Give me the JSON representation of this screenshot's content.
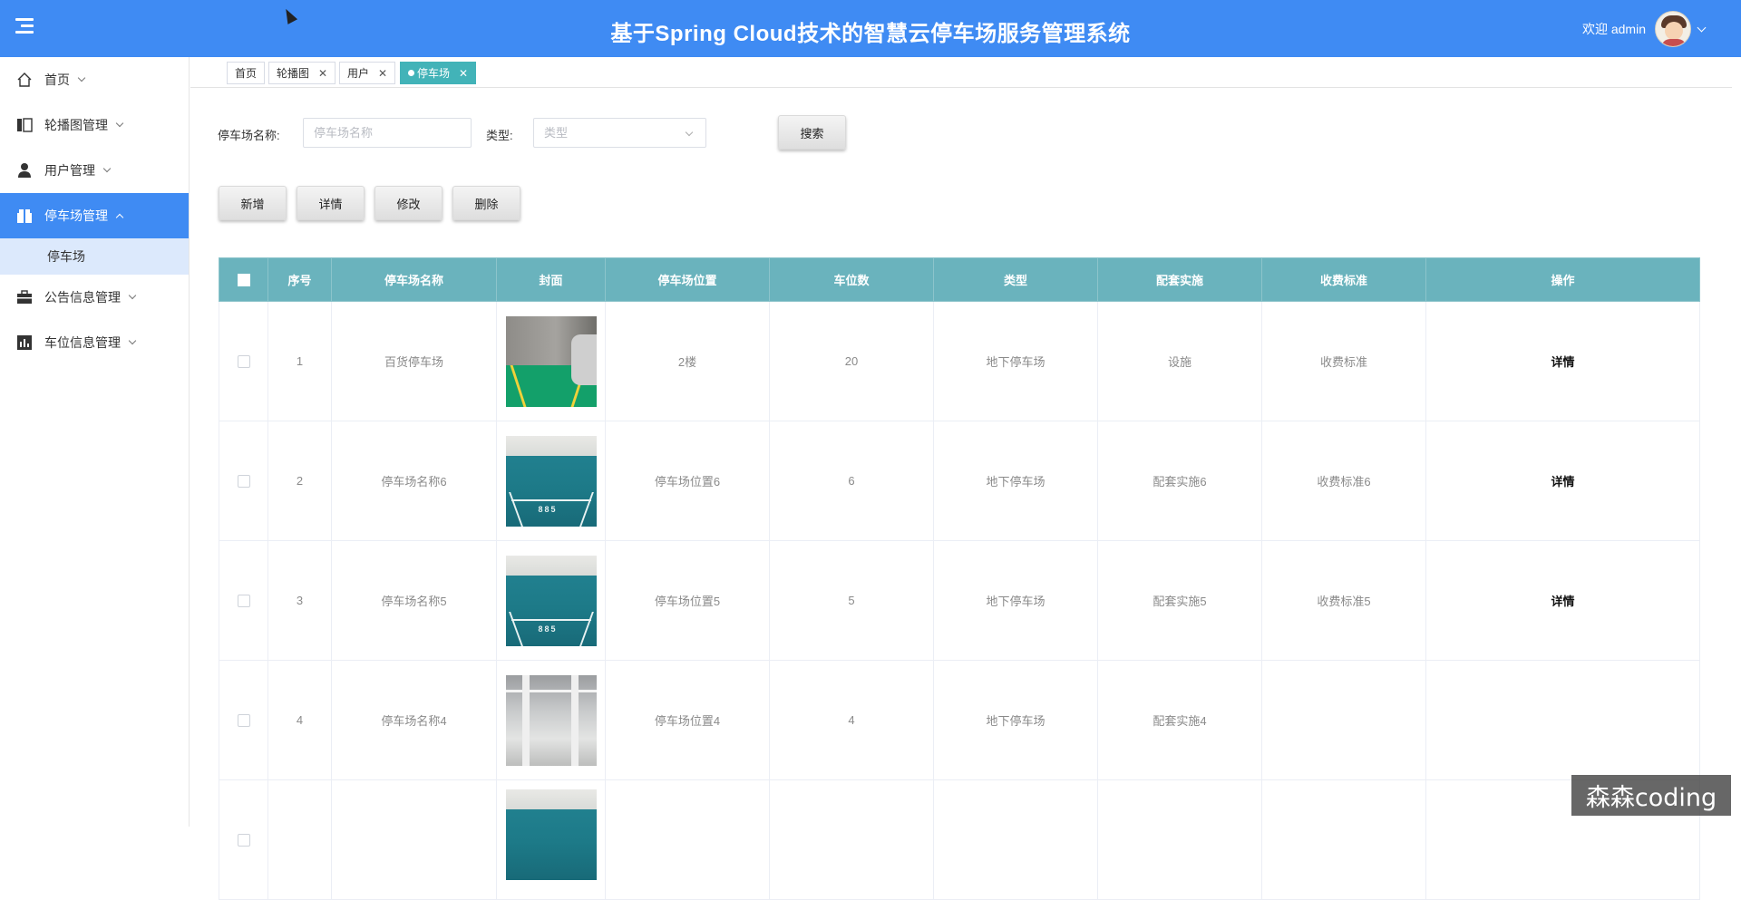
{
  "header": {
    "title": "基于Spring Cloud技术的智慧云停车场服务管理系统",
    "welcome": "欢迎 admin",
    "bg_color": "#3f8bf3"
  },
  "sidebar": {
    "items": [
      {
        "label": "首页",
        "icon": "home-icon"
      },
      {
        "label": "轮播图管理",
        "icon": "carousel-icon"
      },
      {
        "label": "用户管理",
        "icon": "user-icon"
      },
      {
        "label": "停车场管理",
        "icon": "gift-box-icon",
        "active": true
      },
      {
        "label": "公告信息管理",
        "icon": "briefcase-icon"
      },
      {
        "label": "车位信息管理",
        "icon": "bar-chart-icon"
      }
    ],
    "sub_item": "停车场"
  },
  "tabs": [
    {
      "label": "首页",
      "closable": false
    },
    {
      "label": "轮播图",
      "closable": true
    },
    {
      "label": "用户",
      "closable": true
    },
    {
      "label": "停车场",
      "closable": true,
      "active": true
    }
  ],
  "search": {
    "name_label": "停车场名称:",
    "name_placeholder": "停车场名称",
    "type_label": "类型:",
    "type_placeholder": "类型",
    "search_button": "搜索"
  },
  "actions": {
    "add": "新增",
    "detail": "详情",
    "edit": "修改",
    "delete": "删除"
  },
  "table": {
    "headers": [
      "序号",
      "停车场名称",
      "封面",
      "停车场位置",
      "车位数",
      "类型",
      "配套实施",
      "收费标准",
      "操作"
    ],
    "header_color": "#6ab3bd",
    "rows": [
      {
        "index": "1",
        "name": "百货停车场",
        "cover": "green",
        "location": "2楼",
        "spaces": "20",
        "type": "地下停车场",
        "facility": "设施",
        "fee": "收费标准",
        "action": "详情"
      },
      {
        "index": "2",
        "name": "停车场名称6",
        "cover": "teal",
        "location": "停车场位置6",
        "spaces": "6",
        "type": "地下停车场",
        "facility": "配套实施6",
        "fee": "收费标准6",
        "action": "详情"
      },
      {
        "index": "3",
        "name": "停车场名称5",
        "cover": "teal",
        "location": "停车场位置5",
        "spaces": "5",
        "type": "地下停车场",
        "facility": "配套实施5",
        "fee": "收费标准5",
        "action": "详情"
      },
      {
        "index": "4",
        "name": "停车场名称4",
        "cover": "gray",
        "location": "停车场位置4",
        "spaces": "4",
        "type": "地下停车场",
        "facility": "配套实施4",
        "fee": "",
        "action": ""
      }
    ]
  },
  "watermark": "森森coding"
}
